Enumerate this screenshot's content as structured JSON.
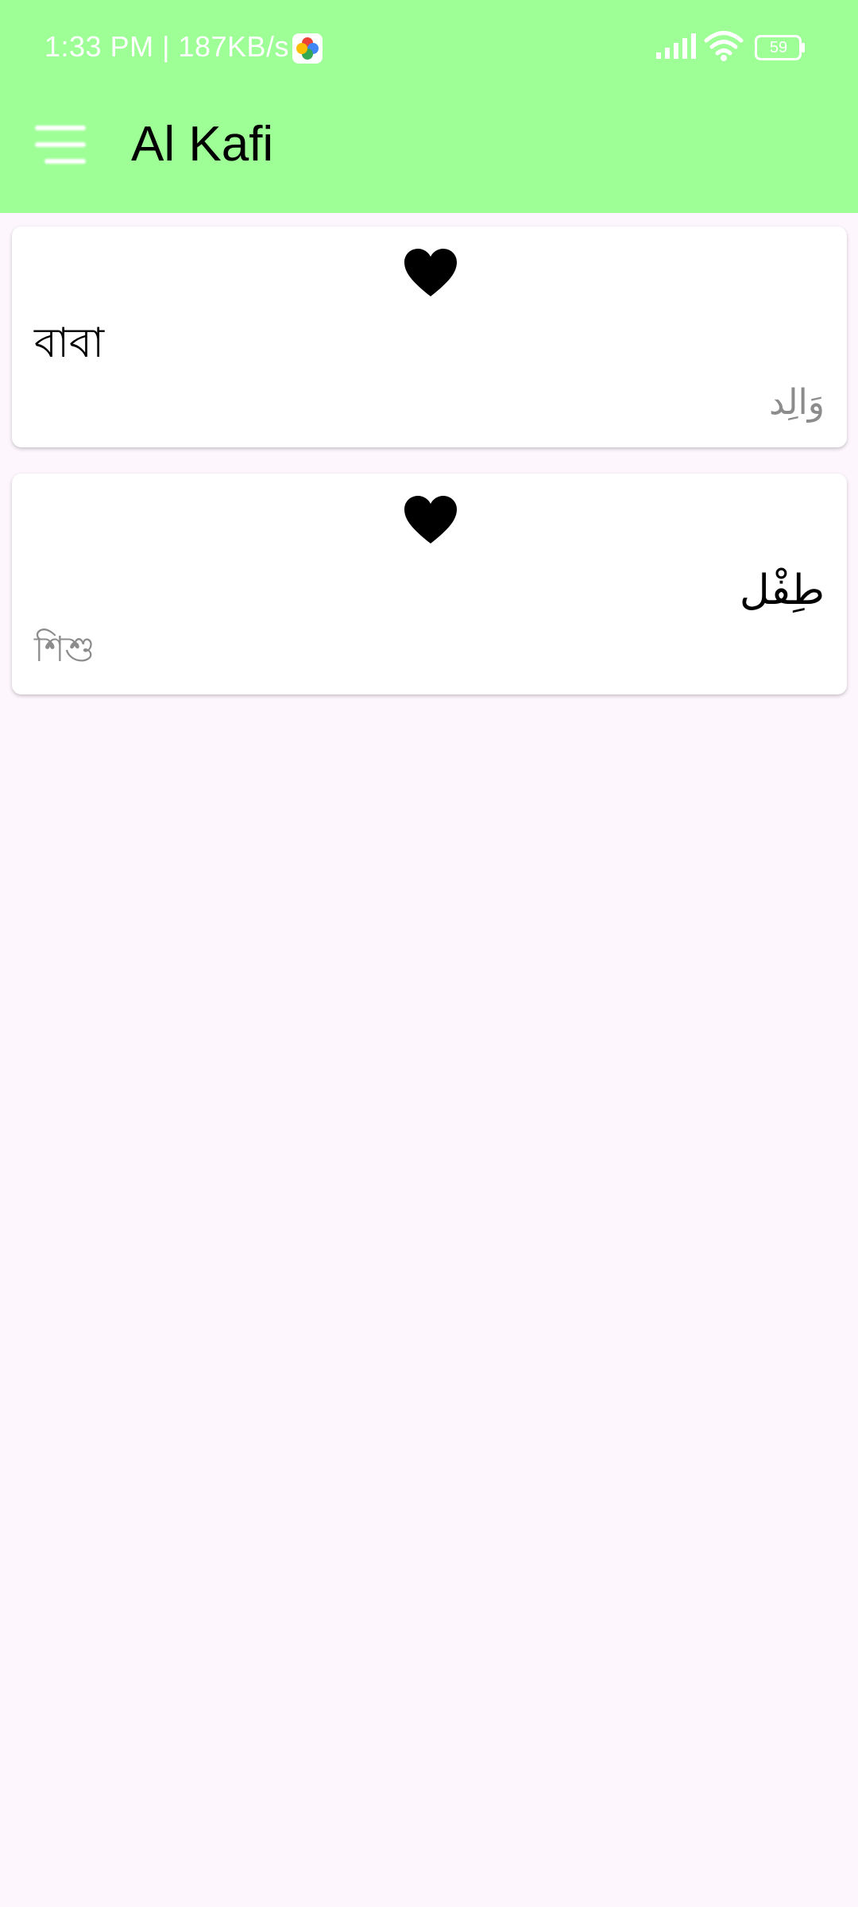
{
  "status_bar": {
    "time_speed": "1:33 PM | 187KB/s",
    "battery_level": "59",
    "icons": [
      "photos-icon",
      "signal-icon",
      "wifi-icon",
      "battery-icon"
    ]
  },
  "app_bar": {
    "title": "Al Kafi",
    "menu_icon": "menu-icon",
    "background_color": "#9DFF96"
  },
  "cards": [
    {
      "favorite_icon": "heart-icon",
      "bengali": "বাবা",
      "arabic": "وَالِد"
    },
    {
      "favorite_icon": "heart-icon",
      "arabic": "طِفْل",
      "bengali": "শিশু"
    }
  ]
}
